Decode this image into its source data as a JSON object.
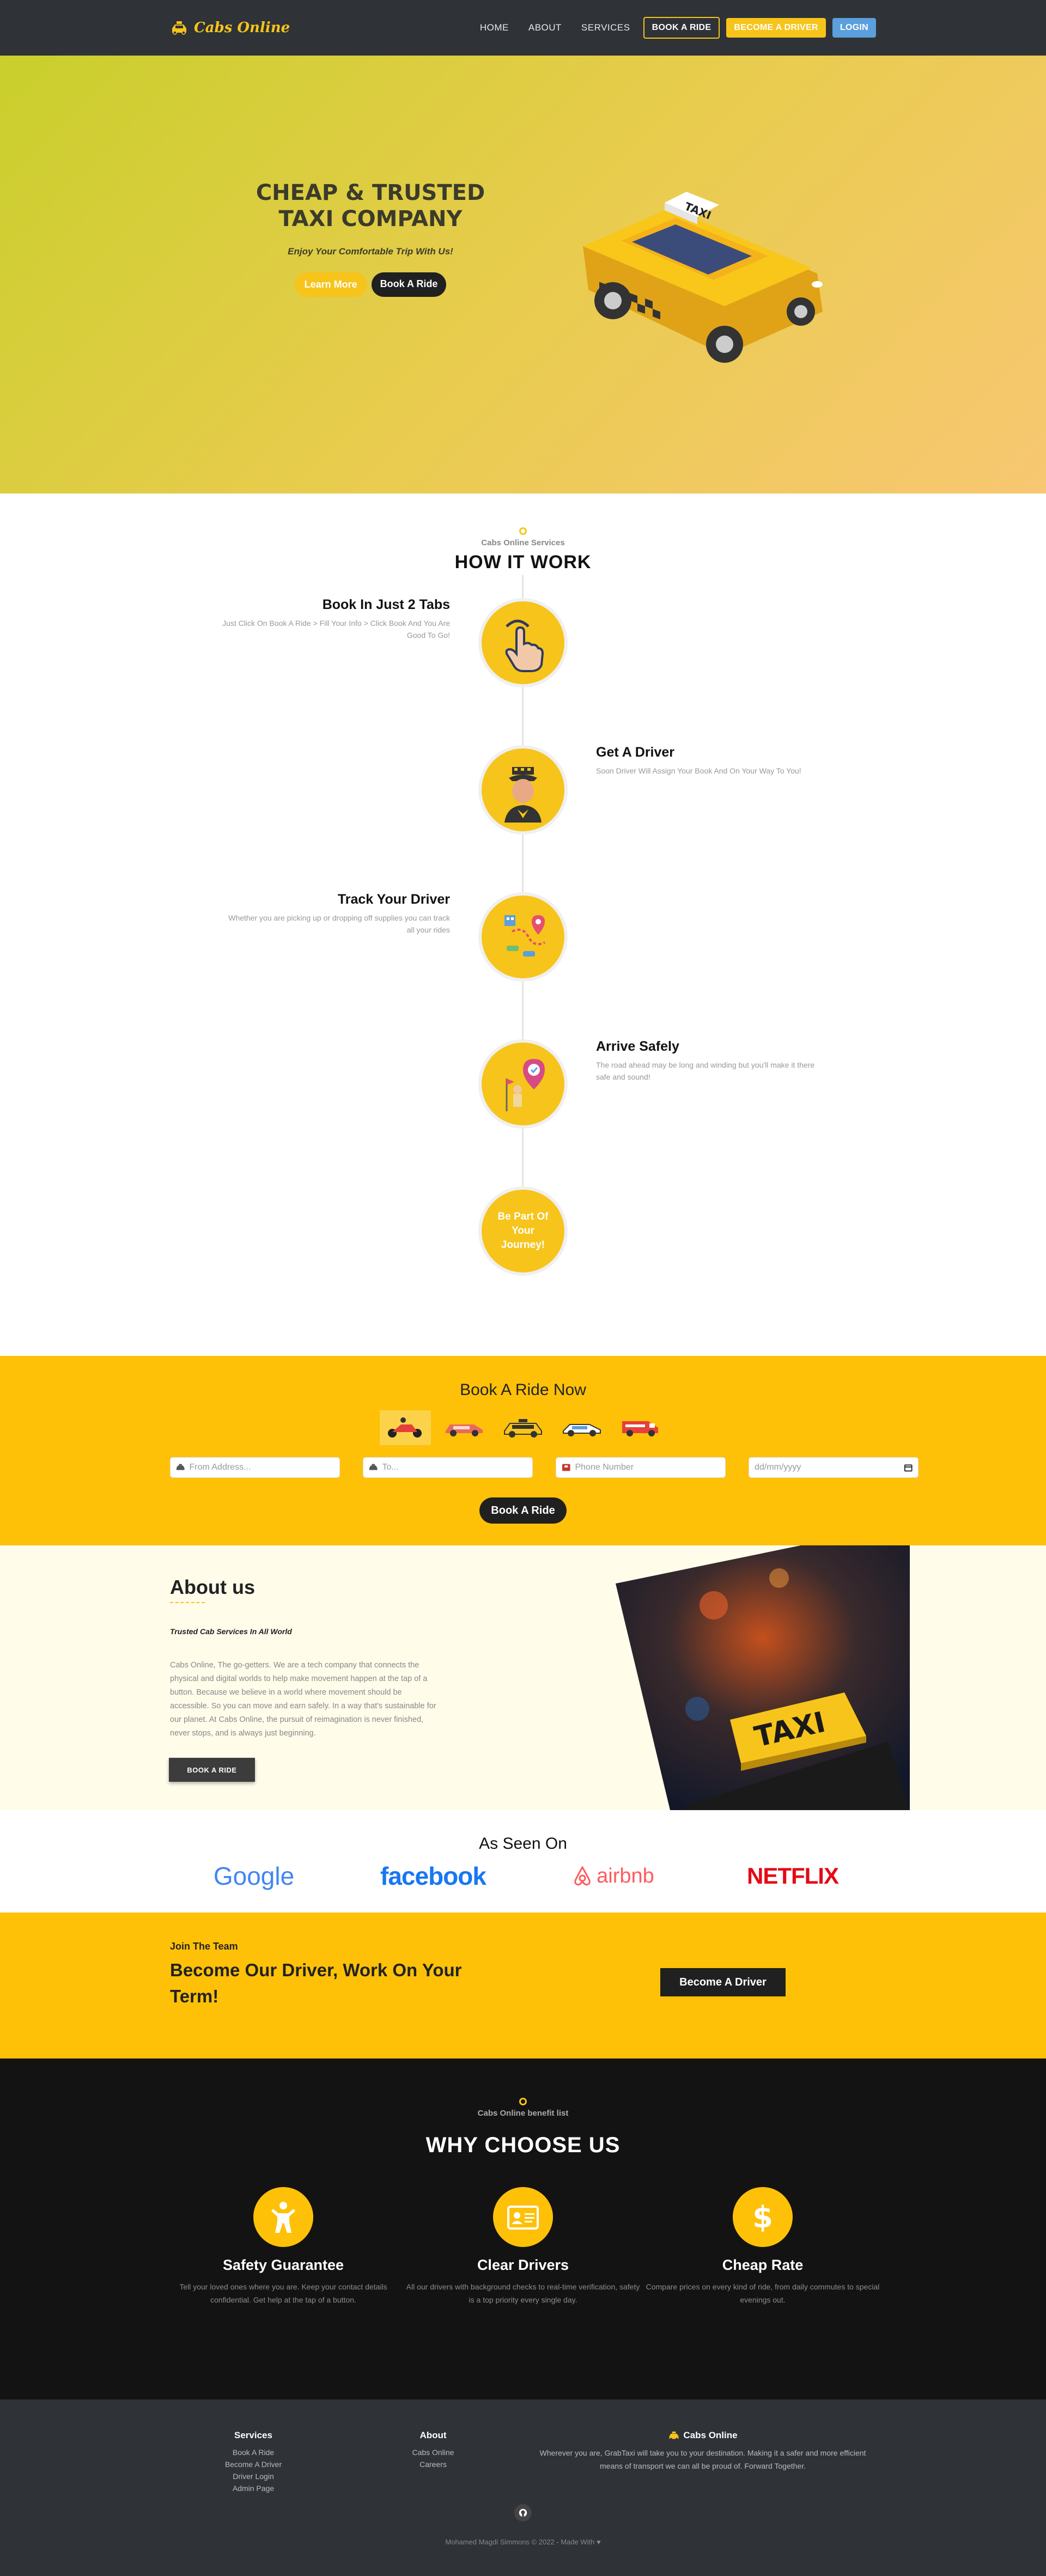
{
  "nav": {
    "brand": "Cabs Online",
    "links": [
      "HOME",
      "ABOUT",
      "SERVICES"
    ],
    "book_ride": "BOOK A RIDE",
    "become_driver": "BECOME A DRIVER",
    "login": "LOGIN"
  },
  "hero": {
    "title_line1": "CHEAP & TRUSTED",
    "title_line2": "TAXI COMPANY",
    "subtitle": "Enjoy Your Comfortable Trip With Us!",
    "learn_more": "Learn More",
    "book_ride": "Book A Ride",
    "taxi_sign": "TAXI"
  },
  "how": {
    "kicker": "Cabs Online Services",
    "title": "HOW IT WORK",
    "steps": [
      {
        "title": "Book In Just 2 Tabs",
        "desc": "Just Click On Book A Ride > Fill Your Info > Click Book And You Are Good To Go!",
        "icon": "hand-tap-icon"
      },
      {
        "title": "Get A Driver",
        "desc": "Soon Driver Will Assign Your Book And On Your Way To You!",
        "icon": "driver-icon"
      },
      {
        "title": "Track Your Driver",
        "desc": "Whether you are picking up or dropping off supplies you can track all your rides",
        "icon": "map-track-icon"
      },
      {
        "title": "Arrive Safely",
        "desc": "The road ahead may be long and winding but you'll make it there safe and sound!",
        "icon": "arrive-pin-icon"
      }
    ],
    "join_circle": "Be Part Of Your Journey!"
  },
  "book": {
    "title": "Book A Ride Now",
    "vehicles": [
      "scooter-icon",
      "sedan-icon",
      "taxi-icon",
      "car-icon",
      "van-icon"
    ],
    "from_placeholder": "From Address...",
    "to_placeholder": "To...",
    "phone_placeholder": "Phone Number",
    "date_placeholder": "dd/mm/yyyy",
    "submit": "Book A Ride"
  },
  "about": {
    "title": "About us",
    "tagline": "Trusted Cab Services In All World",
    "text": "Cabs Online, The go-getters. We are a tech company that connects the physical and digital worlds to help make movement happen at the tap of a button. Because we believe in a world where movement should be accessible. So you can move and earn safely. In a way that's sustainable for our planet. At Cabs Online, the pursuit of reimagination is never finished, never stops, and is always just beginning.",
    "button": "BOOK A RIDE",
    "image_sign": "TAXI"
  },
  "seen": {
    "title": "As Seen On",
    "brands": [
      "Google",
      "facebook",
      "airbnb",
      "NETFLIX"
    ]
  },
  "join": {
    "kicker": "Join The Team",
    "title": "Become Our Driver, Work On Your Term!",
    "button": "Become A Driver"
  },
  "why": {
    "kicker": "Cabs Online benefit list",
    "title": "WHY CHOOSE US",
    "features": [
      {
        "title": "Safety Guarantee",
        "desc": "Tell your loved ones where you are. Keep your contact details confidential. Get help at the tap of a button.",
        "icon": "person-safe-icon"
      },
      {
        "title": "Clear Drivers",
        "desc": "All our drivers with background checks to real-time verification, safety is a top priority every single day.",
        "icon": "id-card-icon"
      },
      {
        "title": "Cheap Rate",
        "desc": "Compare prices on every kind of ride, from daily commutes to special evenings out.",
        "icon": "dollar-icon"
      }
    ]
  },
  "footer": {
    "services_head": "Services",
    "services": [
      "Book A Ride",
      "Become A Driver",
      "Driver Login",
      "Admin Page"
    ],
    "about_head": "About",
    "about_links": [
      "Cabs Online",
      "Careers"
    ],
    "brand_head": "Cabs Online",
    "brand_desc": "Wherever you are, GrabTaxi will take you to your destination. Making it a safer and more efficient means of transport we can all be proud of. Forward Together.",
    "copyright": "Mohamed Magdi Simmons © 2022 - Made With"
  },
  "colors": {
    "accent": "#fec108",
    "dark": "#2f3237",
    "nav_login": "#5b9fdc"
  }
}
